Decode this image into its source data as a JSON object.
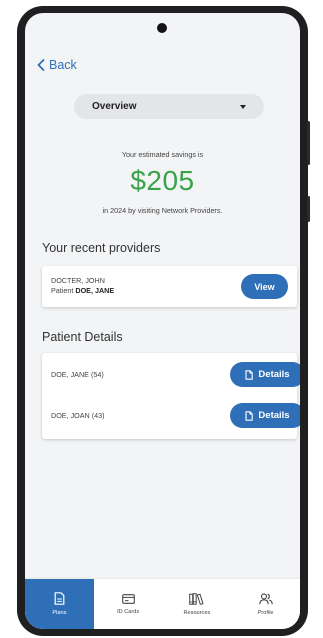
{
  "nav": {
    "back_label": "Back"
  },
  "dropdown": {
    "selected": "Overview"
  },
  "savings": {
    "pre_text": "Your estimated savings is",
    "amount": "$205",
    "post_text": "in 2024 by visiting Network Providers."
  },
  "recent_providers": {
    "title": "Your recent providers",
    "items": [
      {
        "name": "DOCTER, JOHN",
        "patient_prefix": "Patient",
        "patient": "DOE, JANE",
        "button": "View"
      }
    ]
  },
  "patient_details": {
    "title": "Patient Details",
    "items": [
      {
        "name": "DOE, JANE (54)",
        "button": "Details"
      },
      {
        "name": "DOE, JOAN (43)",
        "button": "Details"
      }
    ]
  },
  "tabs": [
    {
      "label": "Plans",
      "icon": "document-icon",
      "active": true
    },
    {
      "label": "ID Cards",
      "icon": "card-icon",
      "active": false
    },
    {
      "label": "Resources",
      "icon": "books-icon",
      "active": false
    },
    {
      "label": "Profile",
      "icon": "people-icon",
      "active": false
    }
  ],
  "colors": {
    "accent": "#2f6fb8",
    "savings_green": "#3aa34a",
    "screen_bg": "#f3f4f6"
  }
}
